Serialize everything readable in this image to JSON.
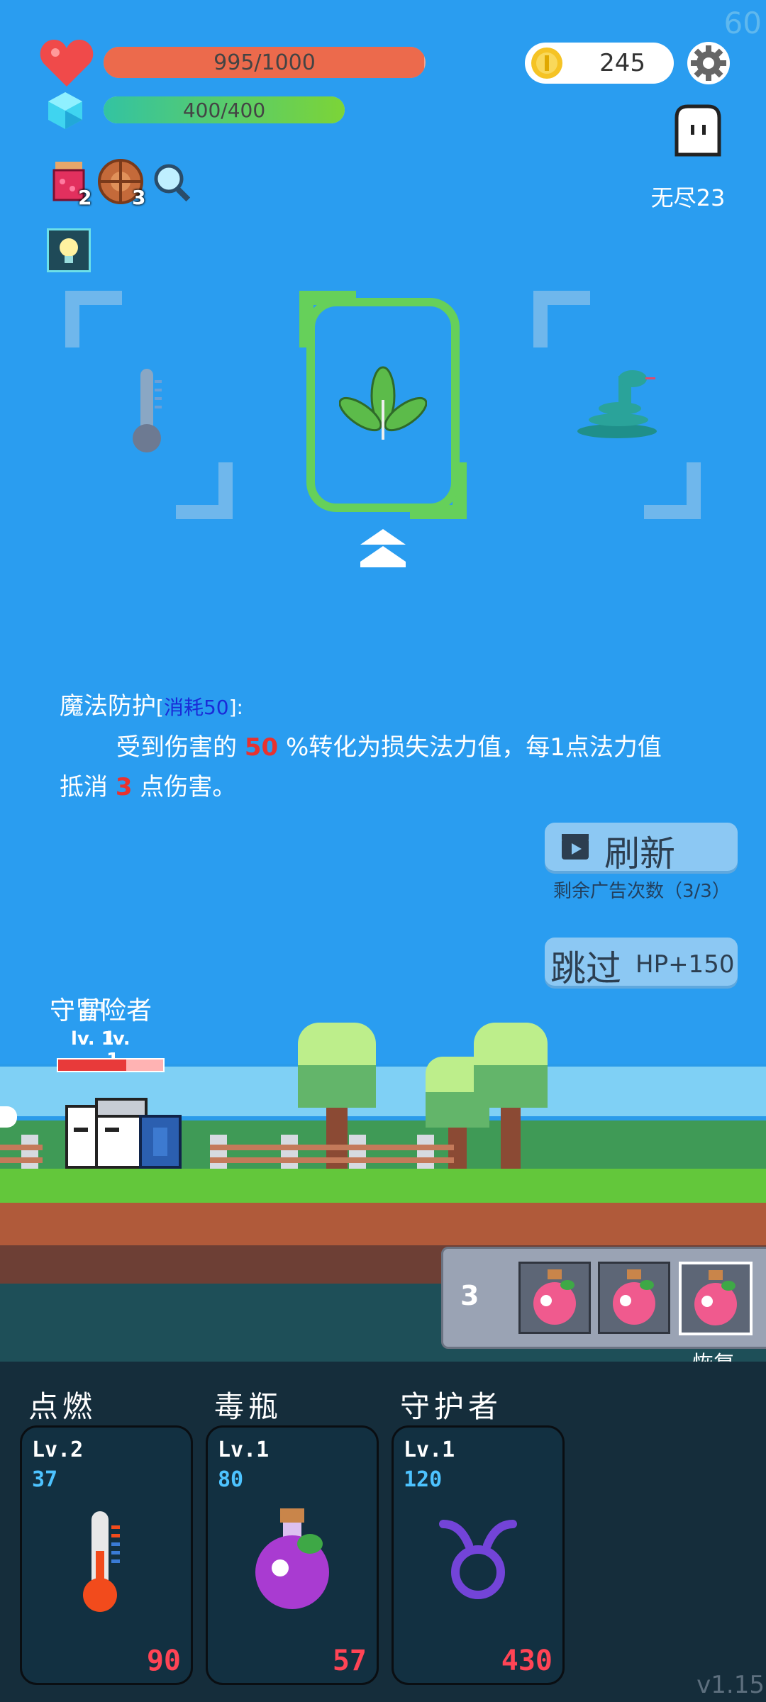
{
  "fps": "60",
  "version": "v1.15",
  "hud": {
    "hp_text": "995/1000",
    "hp_fraction": 0.995,
    "mp_text": "400/400",
    "mp_fraction": 1.0,
    "coins": "245",
    "mode_label": "无尽23",
    "items": [
      {
        "icon": "jam-jar-icon",
        "count": "2"
      },
      {
        "icon": "shield-disc-icon",
        "count": "3"
      },
      {
        "icon": "magnifier-icon",
        "count": ""
      }
    ]
  },
  "choices": [
    {
      "icon": "thermometer-icon"
    },
    {
      "icon": "leaf-sprout-icon",
      "selected": true
    },
    {
      "icon": "snake-icon"
    }
  ],
  "skill_desc": {
    "name": "魔法防护",
    "cost_open": "[",
    "cost": "消耗50",
    "cost_close": "]:",
    "line1_a": "受到伤害的 ",
    "line1_num": "50",
    "line1_b": " %转化为损失法力值，每1点法力值",
    "line2_a": "抵消 ",
    "line2_num": "3",
    "line2_b": " 点伤害。"
  },
  "refresh": {
    "label": "刷新",
    "ads_left": "剩余广告次数（3/3）"
  },
  "skip": {
    "label": "跳过",
    "bonus": "HP+150"
  },
  "player": {
    "name": "守冒险者",
    "level": "lv. 1",
    "name_b": "护",
    "level_b": "lv. 1",
    "hp_fraction": 0.65
  },
  "potions": {
    "count": "3",
    "label": "恢复",
    "slots": [
      "pink-potion-icon",
      "pink-potion-icon",
      "pink-potion-icon"
    ]
  },
  "skills": [
    {
      "title": "点燃",
      "level": "Lv.2",
      "cost": "37",
      "price": "90",
      "icon": "thermometer-icon"
    },
    {
      "title": "毒瓶",
      "level": "Lv.1",
      "cost": "80",
      "price": "57",
      "icon": "poison-flask-icon"
    },
    {
      "title": "守护者",
      "level": "Lv.1",
      "cost": "120",
      "price": "430",
      "icon": "taurus-symbol-icon"
    }
  ],
  "colors": {
    "sky": "#2a9df0",
    "hp": "#ec6a4c",
    "mp": "#4fcf66",
    "highlight_red": "#e8322f",
    "price_red": "#ff4455",
    "cost_blue": "#4dc3ff"
  }
}
